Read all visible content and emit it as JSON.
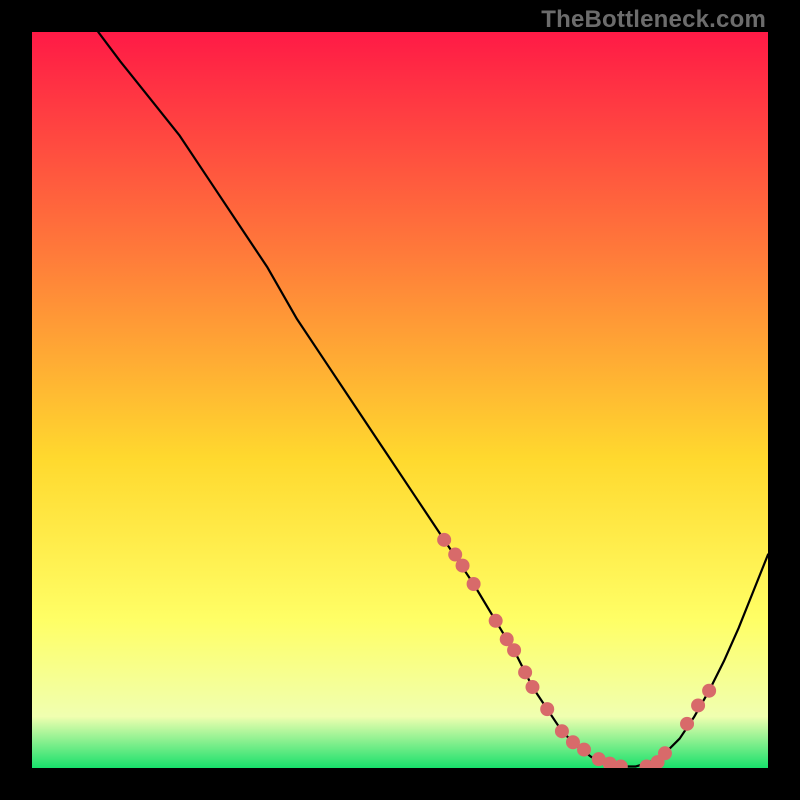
{
  "watermark": "TheBottleneck.com",
  "colors": {
    "gradient_top": "#ff1a46",
    "gradient_mid1": "#ff7a3a",
    "gradient_mid2": "#ffd92e",
    "gradient_mid3": "#ffff66",
    "gradient_mid4": "#f0ffb0",
    "gradient_bottom": "#18e06b",
    "curve": "#000000",
    "dot": "#d86a6a",
    "bg": "#000000"
  },
  "chart_data": {
    "type": "line",
    "title": "",
    "xlabel": "",
    "ylabel": "",
    "xlim": [
      0,
      100
    ],
    "ylim": [
      0,
      100
    ],
    "grid": false,
    "legend": false,
    "x": [
      9,
      12,
      16,
      20,
      24,
      28,
      32,
      36,
      40,
      44,
      48,
      52,
      56,
      60,
      63,
      66,
      68,
      70,
      72,
      74,
      76,
      78,
      80,
      82,
      84,
      86,
      88,
      90,
      92,
      94,
      96,
      98,
      100
    ],
    "values": [
      100,
      96,
      91,
      86,
      80,
      74,
      68,
      61,
      55,
      49,
      43,
      37,
      31,
      25,
      20,
      15,
      11,
      8,
      5,
      3,
      1.5,
      0.6,
      0.2,
      0.2,
      0.8,
      2,
      4,
      7,
      10.5,
      14.5,
      19,
      24,
      29
    ],
    "markers": {
      "x": [
        56,
        57.5,
        58.5,
        60,
        63,
        64.5,
        65.5,
        67,
        68,
        70,
        72,
        73.5,
        75,
        77,
        78.5,
        80,
        83.5,
        85,
        86,
        89,
        90.5,
        92
      ],
      "y": [
        31,
        29,
        27.5,
        25,
        20,
        17.5,
        16,
        13,
        11,
        8,
        5,
        3.5,
        2.5,
        1.2,
        0.6,
        0.2,
        0.2,
        0.8,
        2,
        6,
        8.5,
        10.5
      ]
    }
  }
}
